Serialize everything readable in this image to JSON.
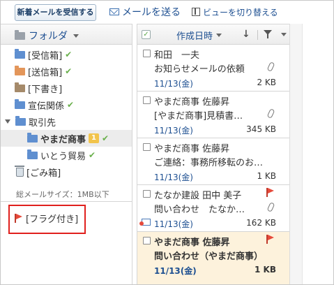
{
  "toolbar": {
    "receive_label": "新着メールを受信する",
    "send_label": "メールを送る",
    "view_label": "ビューを切り替える"
  },
  "folder_panel": {
    "header_label": "フォルダ",
    "folders": [
      {
        "label": "[受信箱]",
        "icon": "folder-blue",
        "checked": true
      },
      {
        "label": "[送信箱]",
        "icon": "folder-orange",
        "checked": true
      },
      {
        "label": "[下書き]",
        "icon": "folder-brown",
        "checked": false
      },
      {
        "label": "宣伝関係",
        "icon": "folder-blue",
        "checked": true
      },
      {
        "label": "取引先",
        "icon": "folder-blue",
        "checked": false,
        "expanded": true
      },
      {
        "label": "やまだ商事",
        "icon": "folder-blue",
        "checked": true,
        "selected": true,
        "unread": "1"
      },
      {
        "label": "いとう貿易",
        "icon": "folder-blue",
        "checked": true
      },
      {
        "label": "[ごみ箱]",
        "icon": "trash",
        "checked": false
      }
    ],
    "total_size": "総メールサイズ：1MB以下",
    "flagged_label": "[フラグ付き]"
  },
  "list_header": {
    "sort_label": "作成日時"
  },
  "mails": [
    {
      "sender": "和田　一夫",
      "subject": "お知らせメールの依頼",
      "date": "11/13(金)",
      "size": "2 KB",
      "attachment": true,
      "flag": false,
      "unread": false
    },
    {
      "sender": "やまだ商事 佐藤昇",
      "subject": "[やまだ商事]見積書…",
      "date": "11/13(金)",
      "size": "345 KB",
      "attachment": true,
      "flag": false,
      "unread": false
    },
    {
      "sender": "やまだ商事 佐藤昇",
      "subject": "ご連絡：事務所移転のお…",
      "date": "11/13(金)",
      "size": "1 KB",
      "attachment": false,
      "flag": false,
      "unread": false
    },
    {
      "sender": "たなか建設 田中 美子",
      "subject": "問い合わせ　たなか…",
      "date": "11/13(金)",
      "size": "162 KB",
      "attachment": true,
      "flag": true,
      "unread": false
    },
    {
      "sender": "やまだ商事 佐藤昇",
      "subject": "問い合わせ（やまだ商事）",
      "date": "11/13(金)",
      "size": "1 KB",
      "attachment": false,
      "flag": true,
      "unread": true
    }
  ],
  "colors": {
    "link_blue": "#1d4f91",
    "check_green": "#6ab04c",
    "flag_red": "#e64a3b",
    "highlight_box": "#e0201d",
    "selected_row": "#fdf2dc",
    "badge": "#f2c44b"
  }
}
